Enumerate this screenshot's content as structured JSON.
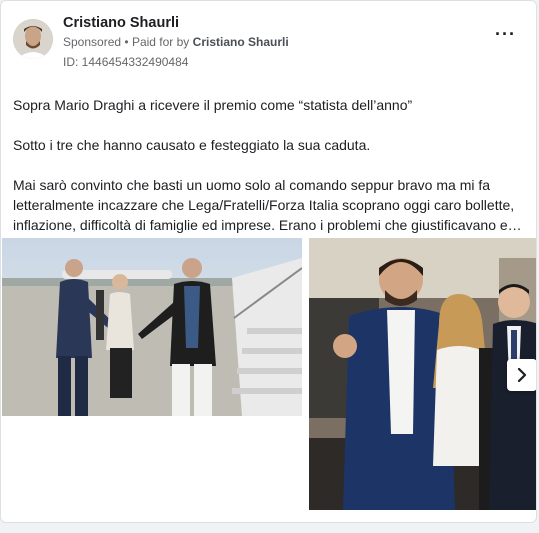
{
  "post": {
    "author": "Cristiano Shaurli",
    "sponsored_label": "Sponsored",
    "separator": "•",
    "paid_for_prefix": "Paid for by",
    "paid_for_name": "Cristiano Shaurli",
    "ad_id": "ID: 1446454332490484",
    "more_icon": "more-options-icon",
    "paragraphs": [
      "Sopra Mario Draghi a ricevere il premio come “statista dell’anno”",
      "Sotto i tre che hanno causato e festeggiato la sua caduta.",
      "Mai sarò convinto che basti un uomo solo al comando seppur bravo ma mi fa letteralmente incazzare che Lega/Fratelli/Forza Italia scoprano oggi caro bollette, inflazione, difficoltà di famiglie ed imprese. Erano i problemi che giustificavano e…"
    ]
  },
  "carousel": {
    "next_icon": "chevron-right-icon",
    "photos": [
      "airport-handshake-photo",
      "three-politicians-photo"
    ]
  },
  "colors": {
    "text": "#1c1e21",
    "secondary": "#65676b",
    "background": "#f0f2f5"
  }
}
